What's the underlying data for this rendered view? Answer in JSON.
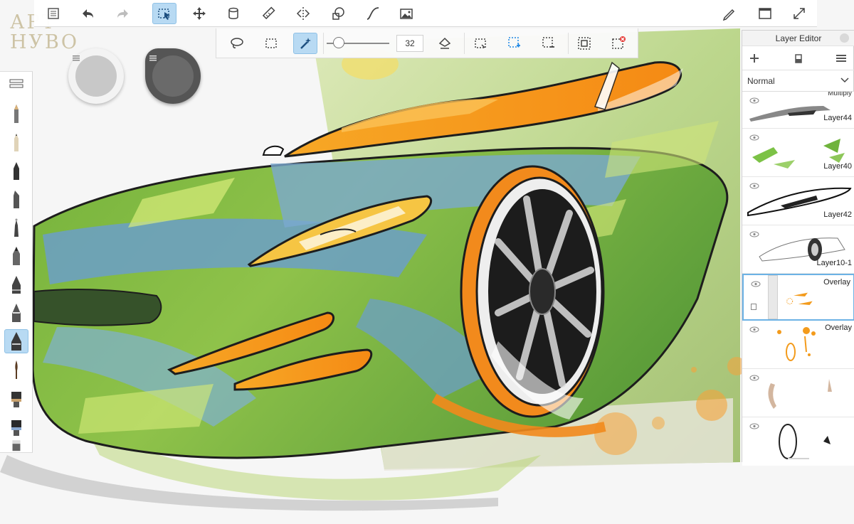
{
  "watermark": {
    "line1": "АРТ",
    "line2": "НУВО"
  },
  "top_toolbar": {
    "tools": [
      {
        "icon": "list-icon"
      },
      {
        "icon": "undo-icon"
      },
      {
        "icon": "redo-icon"
      },
      {
        "icon": "selection-icon",
        "active": true
      },
      {
        "icon": "move-transform-icon"
      },
      {
        "icon": "bucket-fill-icon"
      },
      {
        "icon": "ruler-icon"
      },
      {
        "icon": "symmetry-icon"
      },
      {
        "icon": "shapes-icon"
      },
      {
        "icon": "curve-icon"
      },
      {
        "icon": "image-icon"
      },
      {
        "icon": "pen-edit-icon"
      },
      {
        "icon": "window-icon"
      },
      {
        "icon": "fullscreen-icon"
      }
    ]
  },
  "selection_bar": {
    "tools": [
      "lasso-icon",
      "rectangle-select-icon",
      "magic-wand-icon",
      "brush-size-slider",
      "feather-icon",
      "crop-select-icon",
      "add-select-icon",
      "subtract-select-icon",
      "invert-select-icon",
      "clear-select-icon"
    ],
    "active_tool": "magic-wand-icon",
    "brush_size": "32",
    "slider_level": 0.1
  },
  "brush_palette": {
    "items": [
      "pencil-brush",
      "fine-pencil-brush",
      "marker-brush",
      "chisel-marker-brush",
      "small-airbrush",
      "ink-pen-brush",
      "technical-pen-brush",
      "tall-pen-brush",
      "wide-pen-brush",
      "round-brush",
      "flat-brush",
      "blender-brush",
      "eraser-brush"
    ],
    "active_index": 8
  },
  "colors": {
    "accent": "#1e88e5",
    "puck_primary": "#c8c8c8",
    "puck_secondary": "#6a6a6a",
    "car_body": "#6fae3f",
    "car_blue": "#6b9fc8",
    "car_orange": "#f39b1c"
  },
  "layer_editor": {
    "title": "Layer Editor",
    "blend_mode": "Normal",
    "layers": [
      {
        "name": "Layer44",
        "blend": "Multiply"
      },
      {
        "name": "Layer40"
      },
      {
        "name": "Layer42"
      },
      {
        "name": "Layer10-1"
      },
      {
        "name": "Overlay",
        "selected": true
      },
      {
        "name": "Overlay"
      },
      {
        "name": ""
      },
      {
        "name": ""
      }
    ]
  }
}
